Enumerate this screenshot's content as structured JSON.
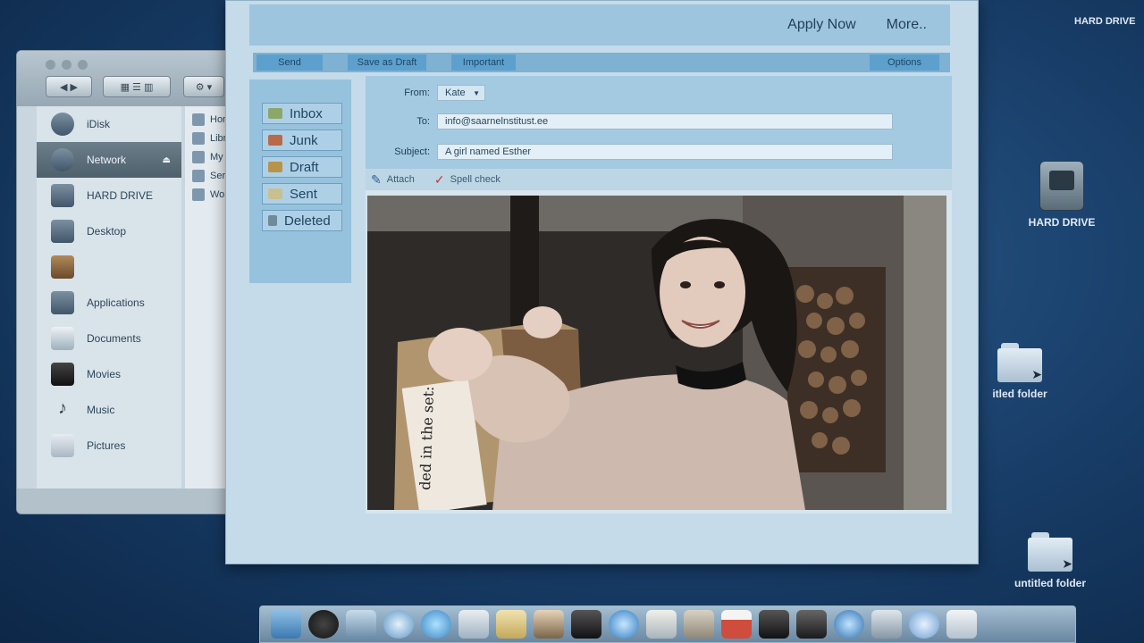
{
  "mail": {
    "topbar": {
      "apply": "Apply Now",
      "more": "More.."
    },
    "actions": {
      "send": "Send",
      "save_draft": "Save as Draft",
      "important": "Important",
      "options": "Options"
    },
    "folders": [
      "Inbox",
      "Junk",
      "Draft",
      "Sent",
      "Deleted"
    ],
    "fields": {
      "from_label": "From:",
      "from_value": "Kate",
      "to_label": "To:",
      "to_value": "info@saarnelnstitust.ee",
      "subject_label": "Subject:",
      "subject_value": "A girl named Esther"
    },
    "attach": {
      "attach": "Attach",
      "spell": "Spell check"
    },
    "photo": {
      "box_text": "ded in the set:"
    }
  },
  "finder": {
    "sidebar": [
      "iDisk",
      "Network",
      "HARD DRIVE",
      "Desktop",
      "",
      "Applications",
      "Documents",
      "Movies",
      "Music",
      "Pictures"
    ],
    "columns": [
      "Home",
      "Library",
      "My Net",
      "Servers",
      "Workgr"
    ]
  },
  "desktop": {
    "hard_drive_partial": "HARD DRIVE",
    "hard_drive": "HARD DRIVE",
    "folder_partial": "itled folder",
    "folder": "untitled folder"
  },
  "colors": {
    "mail_accent": "#7fb1d2",
    "desktop": "#173c66"
  }
}
